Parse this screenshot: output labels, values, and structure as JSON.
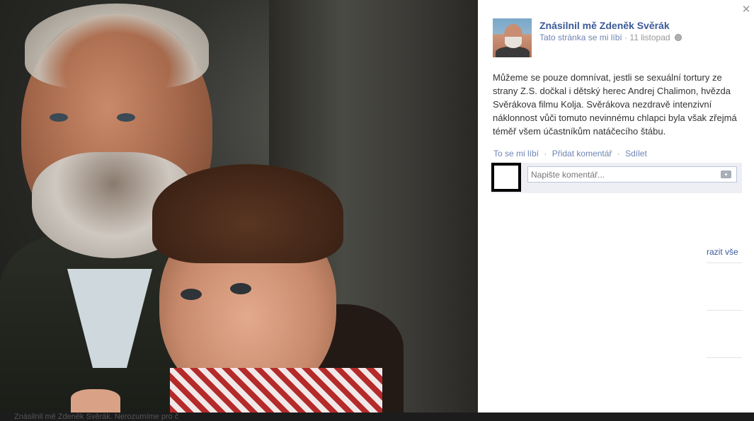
{
  "photo": {
    "alt": "Zdeněk Svěrák a Andrej Chalimon ve filmu Kolja"
  },
  "post": {
    "page_name": "Znásilnil mě Zdeněk Svěrák",
    "like_status": "Tato stránka se mi líbí",
    "date_separator": "·",
    "date": "11 listopad",
    "text": "Můžeme se pouze domnívat, jestli se sexuální tortury ze strany Z.S. dočkal i dětský herec Andrej Chalimon, hvězda Svěrákova filmu Kolja. Svěrákova nezdravě intenzivní náklonnost vůči tomuto nevinnému chlapci byla však zřejmá téměř všem účastníkům natáčecího štábu."
  },
  "actions": {
    "like": "To se mi líbí",
    "comment": "Přidat komentář",
    "share": "Sdílet",
    "separator": "·"
  },
  "comment": {
    "placeholder": "Napište komentář..."
  },
  "sidebar": {
    "show_all_partial": "razit vše"
  },
  "bottom_caption": "Znásilnil mě Zdeněk Svěrák. Nerozumíme pro č",
  "colors": {
    "link": "#3b5998",
    "link_light": "#6d84b4",
    "comment_bg": "#edeff4"
  }
}
